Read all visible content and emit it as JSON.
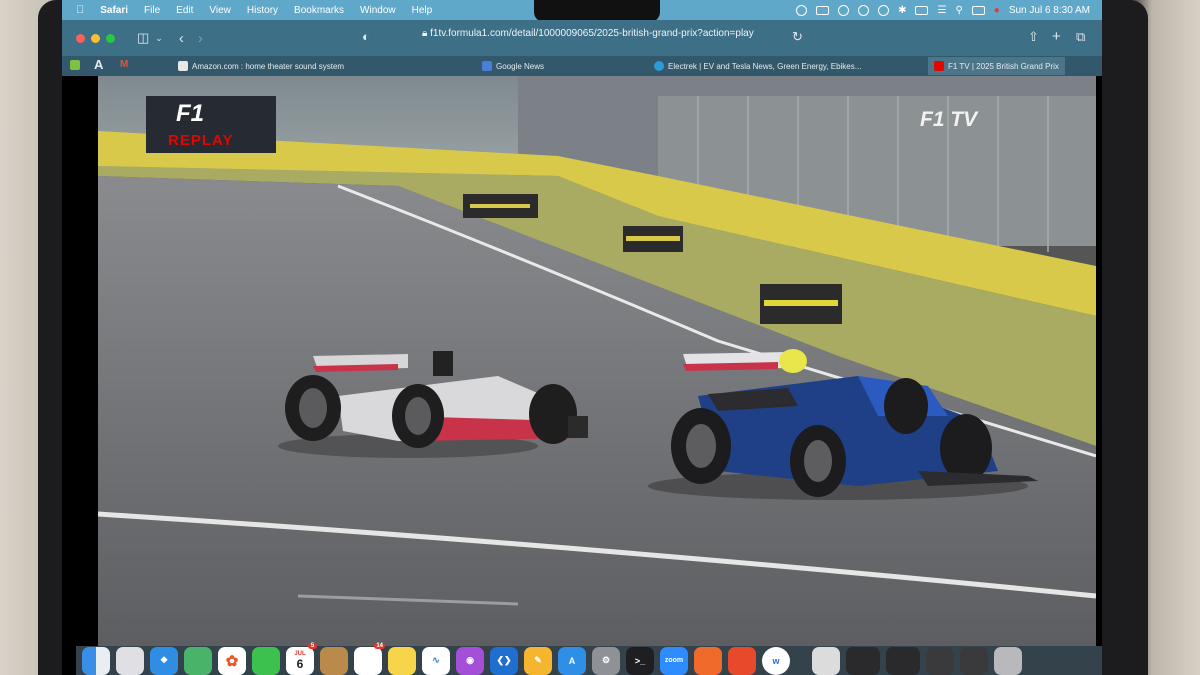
{
  "menubar": {
    "app": "Safari",
    "menus": [
      "File",
      "Edit",
      "View",
      "History",
      "Bookmarks",
      "Window",
      "Help"
    ],
    "datetime": "Sun Jul 6  8:30 AM"
  },
  "toolbar": {
    "url": "f1tv.formula1.com/detail/1000009065/2025-british-grand-prix?action=play"
  },
  "tabs": [
    {
      "label": "Amazon.com : home theater sound system",
      "favicon_color": "#e8e8e8"
    },
    {
      "label": "Google News",
      "favicon_color": "#4a7fd8"
    },
    {
      "label": "Electrek | EV and Tesla News, Green Energy, Ebikes...",
      "favicon_color": "#2d9bd8"
    },
    {
      "label": "F1 TV | 2025 British Grand Prix",
      "favicon_color": "#e10600"
    }
  ],
  "video": {
    "replay_logo_top": "F1",
    "replay_logo_bottom": "REPLAY",
    "watermark": "F1 TV"
  },
  "dock": {
    "calendar_month": "JUL",
    "calendar_day": "6",
    "calendar_badge": "5",
    "reminders_badge": "14",
    "zoom_label": "zoom",
    "terminal_label": ">_"
  },
  "colors": {
    "menubar": "#5fa8c9",
    "toolbar": "#3d6f87",
    "track": "#6f6f71",
    "grass": "#a9ab62",
    "barrier": "#d9c94a",
    "f1_red": "#e10600"
  }
}
